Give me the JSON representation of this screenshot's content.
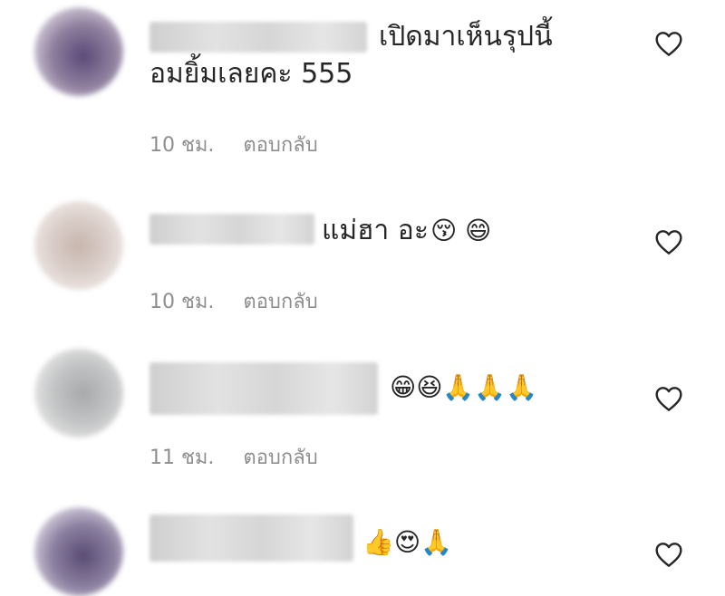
{
  "comments": [
    {
      "line1": "เปิดมาเห็นรุปนี้",
      "line2": "อมยิ้มเลยคะ 555",
      "time": "10 ชม.",
      "reply": "ตอบกลับ"
    },
    {
      "text": "แม่ฮา อะ",
      "emoji": "😚 😄",
      "time": "10 ชม.",
      "reply": "ตอบกลับ"
    },
    {
      "emoji": "😁😆🙏🙏🙏",
      "time": "11 ชม.",
      "reply": "ตอบกลับ"
    },
    {
      "emoji": "👍😍🙏"
    }
  ],
  "icons": {
    "like": "heart-outline-icon"
  }
}
